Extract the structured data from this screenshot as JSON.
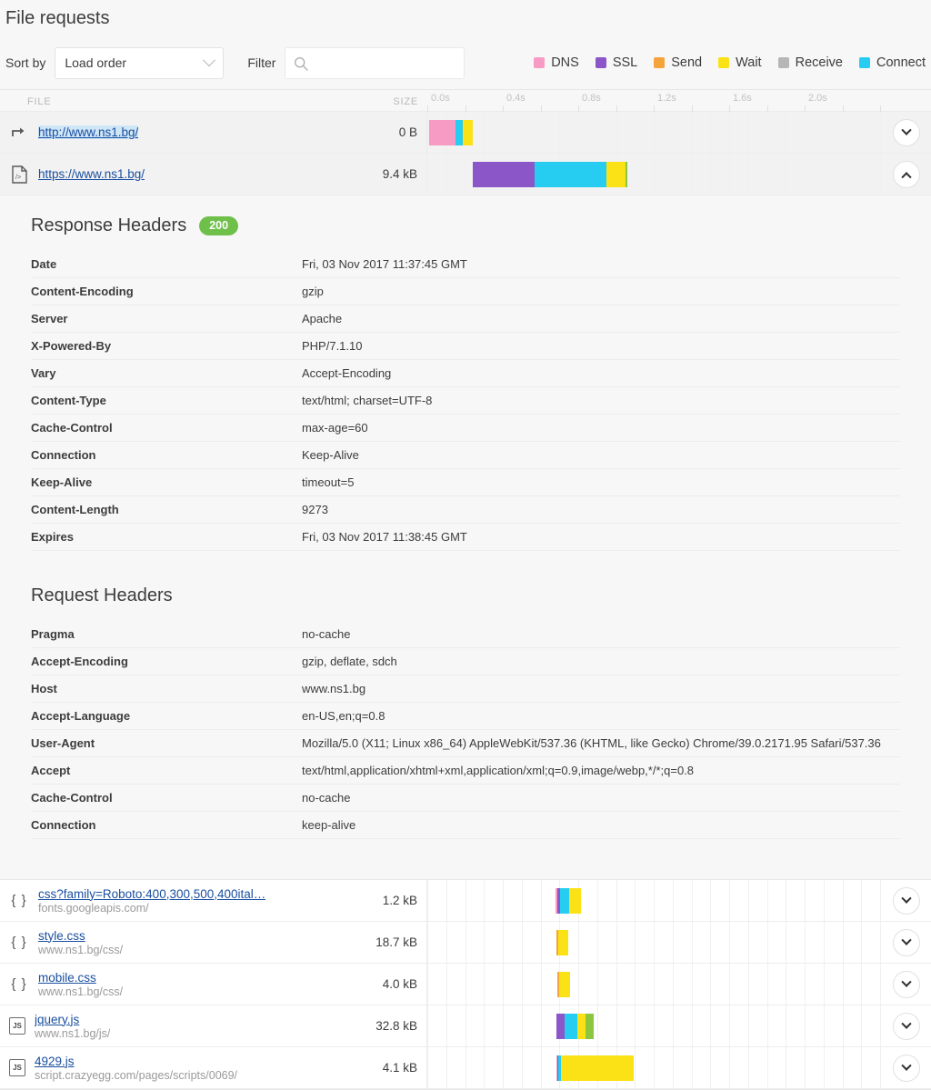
{
  "page_title": "File requests",
  "toolbar": {
    "sort_label": "Sort by",
    "sort_value": "Load order",
    "filter_label": "Filter",
    "filter_value": "",
    "filter_placeholder": ""
  },
  "legend": [
    {
      "label": "DNS",
      "color": "#f79bc4"
    },
    {
      "label": "SSL",
      "color": "#8a56c8"
    },
    {
      "label": "Send",
      "color": "#f5a33c"
    },
    {
      "label": "Wait",
      "color": "#fbe216"
    },
    {
      "label": "Receive",
      "color": "#b6b6b6"
    },
    {
      "label": "Connect",
      "color": "#27cdf0"
    }
  ],
  "columns": {
    "file": "FILE",
    "size": "SIZE"
  },
  "timeline": {
    "ticks": [
      "0.0s",
      "0.4s",
      "0.8s",
      "1.2s",
      "1.6s",
      "2.0s"
    ],
    "axis_max_s": 2.4
  },
  "rows": [
    {
      "icon": "redirect-icon",
      "url": "http://www.ns1.bg/",
      "host": "",
      "size": "0 B",
      "highlighted": true,
      "selected": true,
      "expanded": false,
      "segments": [
        {
          "type": "DNS",
          "color": "#f79bc4",
          "start": 0.01,
          "dur": 0.14
        },
        {
          "type": "Connect",
          "color": "#27cdf0",
          "start": 0.15,
          "dur": 0.04
        },
        {
          "type": "Wait",
          "color": "#fbe216",
          "start": 0.19,
          "dur": 0.05
        }
      ]
    },
    {
      "icon": "html-file-icon",
      "url": "https://www.ns1.bg/",
      "host": "",
      "size": "9.4 kB",
      "highlighted": false,
      "selected": true,
      "expanded": true,
      "segments": [
        {
          "type": "SSL",
          "color": "#8a56c8",
          "start": 0.24,
          "dur": 0.33
        },
        {
          "type": "Connect",
          "color": "#27cdf0",
          "start": 0.57,
          "dur": 0.38
        },
        {
          "type": "Wait",
          "color": "#fbe216",
          "start": 0.95,
          "dur": 0.1
        },
        {
          "type": "Receive",
          "color": "#8cc63e",
          "start": 1.05,
          "dur": 0.01
        }
      ]
    },
    {
      "icon": "css-file-icon",
      "url": "css?family=Roboto:400,300,500,400ital…",
      "host": "fonts.googleapis.com/",
      "size": "1.2 kB",
      "highlighted": false,
      "selected": false,
      "expanded": false,
      "segments": [
        {
          "type": "DNS",
          "color": "#f79bc4",
          "start": 0.68,
          "dur": 0.01
        },
        {
          "type": "SSL",
          "color": "#8a56c8",
          "start": 0.69,
          "dur": 0.012
        },
        {
          "type": "Connect",
          "color": "#27cdf0",
          "start": 0.702,
          "dur": 0.048
        },
        {
          "type": "Wait",
          "color": "#fbe216",
          "start": 0.75,
          "dur": 0.065
        }
      ]
    },
    {
      "icon": "css-file-icon",
      "url": "style.css",
      "host": "www.ns1.bg/css/",
      "size": "18.7 kB",
      "highlighted": false,
      "selected": false,
      "expanded": false,
      "segments": [
        {
          "type": "Send",
          "color": "#f5a33c",
          "start": 0.682,
          "dur": 0.012
        },
        {
          "type": "Wait",
          "color": "#fbe216",
          "start": 0.694,
          "dur": 0.055
        }
      ]
    },
    {
      "icon": "css-file-icon",
      "url": "mobile.css",
      "host": "www.ns1.bg/css/",
      "size": "4.0 kB",
      "highlighted": false,
      "selected": false,
      "expanded": false,
      "segments": [
        {
          "type": "Send",
          "color": "#f5a33c",
          "start": 0.69,
          "dur": 0.01
        },
        {
          "type": "Wait",
          "color": "#fbe216",
          "start": 0.7,
          "dur": 0.055
        }
      ]
    },
    {
      "icon": "js-file-icon",
      "url": "jquery.js",
      "host": "www.ns1.bg/js/",
      "size": "32.8 kB",
      "highlighted": false,
      "selected": false,
      "expanded": false,
      "segments": [
        {
          "type": "SSL",
          "color": "#8a56c8",
          "start": 0.682,
          "dur": 0.045
        },
        {
          "type": "Connect",
          "color": "#27cdf0",
          "start": 0.727,
          "dur": 0.068
        },
        {
          "type": "Wait",
          "color": "#fbe216",
          "start": 0.795,
          "dur": 0.045
        },
        {
          "type": "Receive",
          "color": "#8cc63e",
          "start": 0.84,
          "dur": 0.042
        }
      ]
    },
    {
      "icon": "js-file-icon",
      "url": "4929.js",
      "host": "script.crazyegg.com/pages/scripts/0069/",
      "size": "4.1 kB",
      "highlighted": false,
      "selected": false,
      "expanded": false,
      "segments": [
        {
          "type": "DNS",
          "color": "#f79bc4",
          "start": 0.682,
          "dur": 0.008
        },
        {
          "type": "SSL",
          "color": "#8a56c8",
          "start": 0.69,
          "dur": 0.006
        },
        {
          "type": "Connect",
          "color": "#27cdf0",
          "start": 0.696,
          "dur": 0.012
        },
        {
          "type": "Wait",
          "color": "#fbe216",
          "start": 0.708,
          "dur": 0.385
        }
      ]
    }
  ],
  "detail": {
    "response_title": "Response Headers",
    "status_code": "200",
    "status_color": "#6fc04b",
    "response_headers": [
      {
        "name": "Date",
        "value": "Fri, 03 Nov 2017 11:37:45 GMT"
      },
      {
        "name": "Content-Encoding",
        "value": "gzip"
      },
      {
        "name": "Server",
        "value": "Apache"
      },
      {
        "name": "X-Powered-By",
        "value": "PHP/7.1.10"
      },
      {
        "name": "Vary",
        "value": "Accept-Encoding"
      },
      {
        "name": "Content-Type",
        "value": "text/html; charset=UTF-8"
      },
      {
        "name": "Cache-Control",
        "value": "max-age=60"
      },
      {
        "name": "Connection",
        "value": "Keep-Alive"
      },
      {
        "name": "Keep-Alive",
        "value": "timeout=5"
      },
      {
        "name": "Content-Length",
        "value": "9273"
      },
      {
        "name": "Expires",
        "value": "Fri, 03 Nov 2017 11:38:45 GMT"
      }
    ],
    "request_title": "Request Headers",
    "request_headers": [
      {
        "name": "Pragma",
        "value": "no-cache"
      },
      {
        "name": "Accept-Encoding",
        "value": "gzip, deflate, sdch"
      },
      {
        "name": "Host",
        "value": "www.ns1.bg"
      },
      {
        "name": "Accept-Language",
        "value": "en-US,en;q=0.8"
      },
      {
        "name": "User-Agent",
        "value": "Mozilla/5.0 (X11; Linux x86_64) AppleWebKit/537.36 (KHTML, like Gecko) Chrome/39.0.2171.95 Safari/537.36"
      },
      {
        "name": "Accept",
        "value": "text/html,application/xhtml+xml,application/xml;q=0.9,image/webp,*/*;q=0.8"
      },
      {
        "name": "Cache-Control",
        "value": "no-cache"
      },
      {
        "name": "Connection",
        "value": "keep-alive"
      }
    ]
  }
}
